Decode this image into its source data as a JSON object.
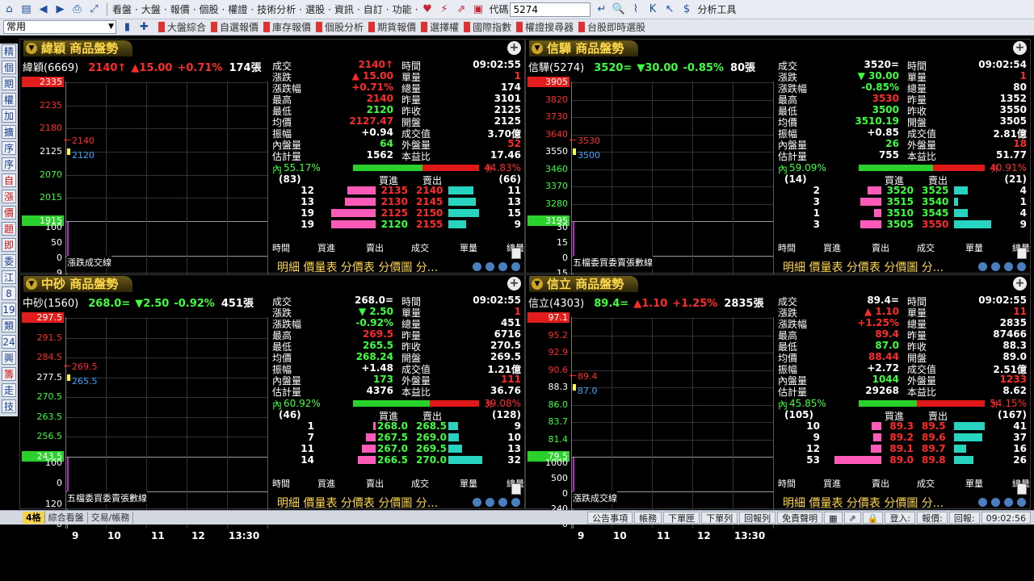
{
  "toolbar": {
    "menus": [
      "看盤",
      "大盤",
      "報價",
      "個股",
      "權證",
      "技術分析",
      "選股",
      "資訊",
      "自訂",
      "功能"
    ],
    "code_label": "代碼",
    "code_value": "5274",
    "analysis_tools": "分析工具"
  },
  "toolbar2": {
    "combo_value": "常用",
    "quick_buttons": [
      "大盤綜合",
      "自選報價",
      "庫存報價",
      "個股分析",
      "期貨報價",
      "選擇權",
      "國際指數",
      "權證搜尋器",
      "台股即時選股"
    ]
  },
  "sidebar": [
    "精",
    "個",
    "期",
    "權",
    "加",
    "擴",
    "序",
    "序",
    "自",
    "漲",
    "價",
    "題",
    "即",
    "委",
    "江",
    "8",
    "19",
    "類",
    "24",
    "興",
    "籌",
    "走",
    "技"
  ],
  "bottombar": {
    "tabs": [
      "4格",
      "綜合看盤",
      "交易/帳務"
    ],
    "right": [
      "公告事項",
      "帳務",
      "下單匣",
      "下單列",
      "回報列",
      "免責聲明"
    ],
    "login": "登入:",
    "quote": "報價:",
    "reply": "回報:",
    "time": "09:02:56"
  },
  "panels": [
    {
      "title": "緯穎 商品盤勢",
      "name": "緯穎(6669)",
      "price": "2140↑",
      "dir": "▲",
      "chg": "15.00",
      "pct": "+0.71%",
      "vol": "174張",
      "yaxis": [
        "2335",
        "2235",
        "2180",
        "2125",
        "2070",
        "2015",
        "1915"
      ],
      "vaxis": [
        "100",
        "50",
        "0",
        "9",
        "0"
      ],
      "arrow_hi": "2140",
      "arrow_lo": "2120",
      "vline_label": "漲跌成交線",
      "xaxis": [
        "9",
        "10",
        "11",
        "12",
        "13:30"
      ],
      "fields": [
        [
          "成交",
          "2140↑",
          "時間",
          "09:02:55"
        ],
        [
          "漲跌",
          "▲ 15.00",
          "單量",
          "1"
        ],
        [
          "漲跌幅",
          "+0.71%",
          "總量",
          "174"
        ],
        [
          "最高",
          "2140",
          "昨量",
          "3101"
        ],
        [
          "最低",
          "2120",
          "昨收",
          "2125"
        ],
        [
          "均價",
          "2127.47",
          "開盤",
          "2125"
        ],
        [
          "振幅",
          "+0.94",
          "成交值",
          "3.70億"
        ],
        [
          "內盤量",
          "64",
          "外盤量",
          "52"
        ],
        [
          "估計量",
          "1562",
          "本益比",
          "17.46"
        ]
      ],
      "in_pct": "55.17%",
      "out_pct": "44.83%",
      "in_ratio": 0.5517,
      "ob_left": "(83)",
      "ob_right": "(66)",
      "bid_h": "買進",
      "ask_h": "賣出",
      "book": [
        [
          "12",
          "2135",
          "2140",
          "11",
          0.6,
          0.65
        ],
        [
          "13",
          "2130",
          "2145",
          "13",
          0.65,
          0.7
        ],
        [
          "19",
          "2125",
          "2150",
          "15",
          0.95,
          0.8
        ],
        [
          "19",
          "2120",
          "2155",
          "9",
          0.95,
          0.45
        ]
      ],
      "dheads": [
        "時間",
        "買進",
        "賣出",
        "成交",
        "單量",
        "總量"
      ],
      "mtabs": "明細 價量表 分價表 分價圖 分..."
    },
    {
      "title": "信驊 商品盤勢",
      "name": "信驊(5274)",
      "price": "3520=",
      "dir": "▼",
      "chg": "30.00",
      "pct": "-0.85%",
      "vol": "80張",
      "yaxis": [
        "3905",
        "3820",
        "3730",
        "3640",
        "3550",
        "3460",
        "3370",
        "3280",
        "3195"
      ],
      "vaxis": [
        "30",
        "15",
        "0",
        "15",
        "0"
      ],
      "arrow_hi": "3530",
      "arrow_lo": "3500",
      "vline_label": "五檔委買委賣張數線",
      "xaxis": [
        "9",
        "10",
        "11",
        "12",
        "13:30"
      ],
      "fields": [
        [
          "成交",
          "3520=",
          "時間",
          "09:02:54"
        ],
        [
          "漲跌",
          "▼ 30.00",
          "單量",
          "1"
        ],
        [
          "漲跌幅",
          "-0.85%",
          "總量",
          "80"
        ],
        [
          "最高",
          "3530",
          "昨量",
          "1352"
        ],
        [
          "最低",
          "3500",
          "昨收",
          "3550"
        ],
        [
          "均價",
          "3510.19",
          "開盤",
          "3505"
        ],
        [
          "振幅",
          "+0.85",
          "成交值",
          "2.81億"
        ],
        [
          "內盤量",
          "26",
          "外盤量",
          "18"
        ],
        [
          "估計量",
          "755",
          "本益比",
          "51.77"
        ]
      ],
      "in_pct": "59.09%",
      "out_pct": "40.91%",
      "in_ratio": 0.5909,
      "ob_left": "(14)",
      "ob_right": "(21)",
      "bid_h": "買進",
      "ask_h": "賣出",
      "book": [
        [
          "2",
          "3520",
          "3525",
          "4",
          0.3,
          0.35
        ],
        [
          "3",
          "3515",
          "3540",
          "1",
          0.45,
          0.1
        ],
        [
          "1",
          "3510",
          "3545",
          "4",
          0.15,
          0.35
        ],
        [
          "3",
          "3505",
          "3550",
          "9",
          0.45,
          0.95
        ]
      ],
      "dheads": [
        "時間",
        "買進",
        "賣出",
        "成交",
        "單量",
        "總量"
      ],
      "mtabs": "明細 價量表 分價表 分價圖 分..."
    },
    {
      "title": "中砂 商品盤勢",
      "name": "中砂(1560)",
      "price": "268.0=",
      "dir": "▼",
      "chg": "2.50",
      "pct": "-0.92%",
      "vol": "451張",
      "yaxis": [
        "297.5",
        "291.5",
        "284.5",
        "277.5",
        "270.5",
        "263.5",
        "256.5",
        "243.5"
      ],
      "vaxis": [
        "100",
        "0",
        "120",
        "0"
      ],
      "arrow_hi": "269.5",
      "arrow_lo": "265.5",
      "vline_label": "五檔委買委賣張數線",
      "xaxis": [
        "9",
        "10",
        "11",
        "12",
        "13:30"
      ],
      "fields": [
        [
          "成交",
          "268.0=",
          "時間",
          "09:02:55"
        ],
        [
          "漲跌",
          "▼ 2.50",
          "單量",
          "1"
        ],
        [
          "漲跌幅",
          "-0.92%",
          "總量",
          "451"
        ],
        [
          "最高",
          "269.5",
          "昨量",
          "6716"
        ],
        [
          "最低",
          "265.5",
          "昨收",
          "270.5"
        ],
        [
          "均價",
          "268.24",
          "開盤",
          "269.5"
        ],
        [
          "振幅",
          "+1.48",
          "成交值",
          "1.21億"
        ],
        [
          "內盤量",
          "173",
          "外盤量",
          "111"
        ],
        [
          "估計量",
          "4376",
          "本益比",
          "36.76"
        ]
      ],
      "in_pct": "60.92%",
      "out_pct": "39.08%",
      "in_ratio": 0.6092,
      "ob_left": "(46)",
      "ob_right": "(128)",
      "bid_h": "買進",
      "ask_h": "賣出",
      "book": [
        [
          "1",
          "268.0",
          "268.5",
          "9",
          0.05,
          0.25
        ],
        [
          "7",
          "267.5",
          "269.0",
          "10",
          0.2,
          0.28
        ],
        [
          "11",
          "267.0",
          "269.5",
          "13",
          0.3,
          0.36
        ],
        [
          "14",
          "266.5",
          "270.0",
          "32",
          0.38,
          0.88
        ]
      ],
      "dheads": [
        "時間",
        "買進",
        "賣出",
        "成交",
        "單量",
        "總量"
      ],
      "mtabs": "明細 價量表 分價表 分價圖 分..."
    },
    {
      "title": "信立 商品盤勢",
      "name": "信立(4303)",
      "price": "89.4=",
      "dir": "▲",
      "chg": "1.10",
      "pct": "+1.25%",
      "vol": "2835張",
      "yaxis": [
        "97.1",
        "95.2",
        "92.9",
        "90.6",
        "88.3",
        "86.0",
        "83.7",
        "81.4",
        "79.5"
      ],
      "vaxis": [
        "1000",
        "500",
        "0",
        "240",
        "0"
      ],
      "arrow_hi": "89.4",
      "arrow_lo": "87.0",
      "vline_label": "漲跌成交線",
      "xaxis": [
        "9",
        "10",
        "11",
        "12",
        "13:30"
      ],
      "fields": [
        [
          "成交",
          "89.4=",
          "時間",
          "09:02:55"
        ],
        [
          "漲跌",
          "▲ 1.10",
          "單量",
          "11"
        ],
        [
          "漲跌幅",
          "+1.25%",
          "總量",
          "2835"
        ],
        [
          "最高",
          "89.4",
          "昨量",
          "87466"
        ],
        [
          "最低",
          "87.0",
          "昨收",
          "88.3"
        ],
        [
          "均價",
          "88.44",
          "開盤",
          "89.0"
        ],
        [
          "振幅",
          "+2.72",
          "成交值",
          "2.51億"
        ],
        [
          "內盤量",
          "1044",
          "外盤量",
          "1233"
        ],
        [
          "估計量",
          "29268",
          "本益比",
          "8.62"
        ]
      ],
      "in_pct": "45.85%",
      "out_pct": "54.15%",
      "in_ratio": 0.4585,
      "ob_left": "(105)",
      "ob_right": "(167)",
      "bid_h": "買進",
      "ask_h": "賣出",
      "book": [
        [
          "10",
          "89.3",
          "89.5",
          "41",
          0.2,
          0.8
        ],
        [
          "9",
          "89.2",
          "89.6",
          "37",
          0.18,
          0.72
        ],
        [
          "12",
          "89.1",
          "89.7",
          "16",
          0.23,
          0.31
        ],
        [
          "53",
          "89.0",
          "89.8",
          "26",
          1.0,
          0.5
        ]
      ],
      "dheads": [
        "時間",
        "買進",
        "賣出",
        "成交",
        "單量",
        "總量"
      ],
      "mtabs": "明細 價量表 分價表 分價圖 分..."
    }
  ]
}
